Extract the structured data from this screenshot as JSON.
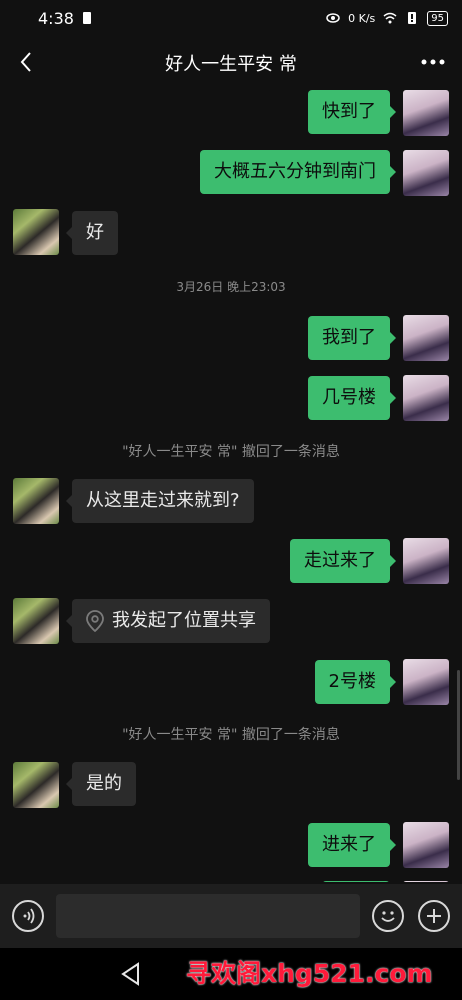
{
  "status": {
    "time": "4:38",
    "net_speed": "0 K/s",
    "battery": "95"
  },
  "header": {
    "title": "好人一生平安 常"
  },
  "messages": {
    "m1": "快到了",
    "m2": "大概五六分钟到南门",
    "m3": "好",
    "ts1": "3月26日 晚上23:03",
    "m4": "我到了",
    "m5": "几号楼",
    "recall1": "\"好人一生平安 常\" 撤回了一条消息",
    "m6": "从这里走过来就到?",
    "m7": "走过来了",
    "m8": "我发起了位置共享",
    "m9": "2号楼",
    "recall2": "\"好人一生平安 常\" 撤回了一条消息",
    "m10": "是的",
    "m11": "进来了"
  },
  "input": {
    "value": ""
  },
  "watermark": "寻欢阁xhg521.com",
  "colors": {
    "bubble_out": "#3dbd6f",
    "bubble_in": "#2b2b2b",
    "background": "#111111"
  }
}
